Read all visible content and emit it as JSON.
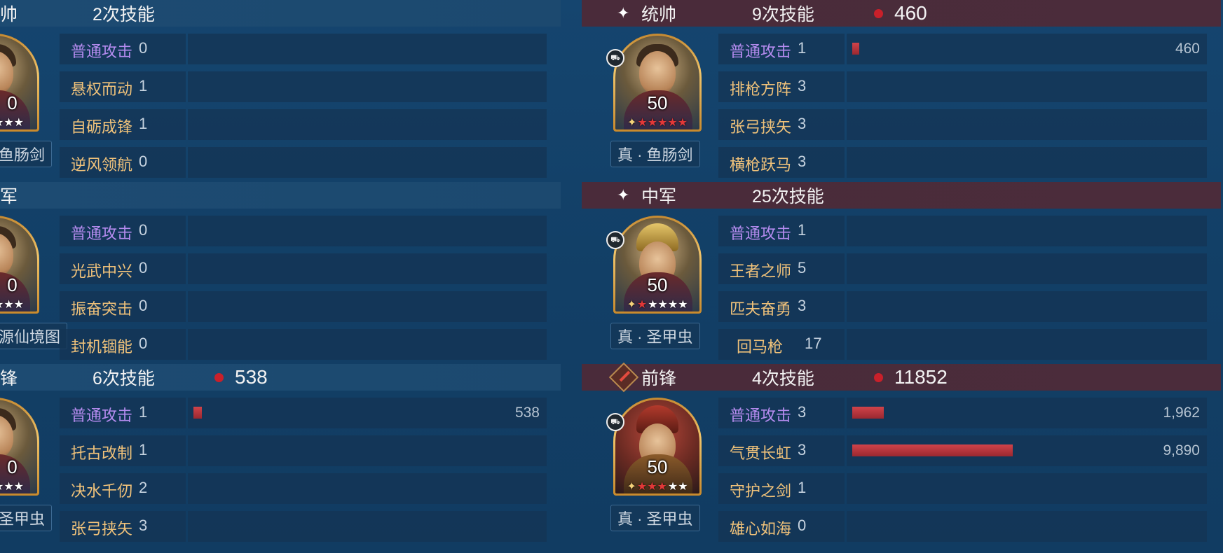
{
  "left_panel": {
    "sections": [
      {
        "role": "帅",
        "skills_label": "2次技能",
        "level": "0",
        "weapon": "鱼肠剑",
        "rows": [
          {
            "name": "普通攻击",
            "count": "0"
          },
          {
            "name": "悬权而动",
            "count": "1"
          },
          {
            "name": "自砺成锋",
            "count": "1"
          },
          {
            "name": "逆风领航",
            "count": "0"
          }
        ]
      },
      {
        "role": "军",
        "skills_label": "",
        "level": "0",
        "weapon": "源仙境图",
        "rows": [
          {
            "name": "普通攻击",
            "count": "0"
          },
          {
            "name": "光武中兴",
            "count": "0"
          },
          {
            "name": "振奋突击",
            "count": "0"
          },
          {
            "name": "封机锢能",
            "count": "0"
          }
        ]
      },
      {
        "role": "锋",
        "skills_label": "6次技能",
        "damage": "538",
        "level": "0",
        "weapon": "圣甲虫",
        "rows": [
          {
            "name": "普通攻击",
            "count": "1",
            "bar_fraction": 0.025,
            "value": "538"
          },
          {
            "name": "托古改制",
            "count": "1"
          },
          {
            "name": "决水千仞",
            "count": "2"
          },
          {
            "name": "张弓挟矢",
            "count": "3"
          }
        ]
      }
    ]
  },
  "right_panel": {
    "sections": [
      {
        "role": "统帅",
        "skills_label": "9次技能",
        "damage": "460",
        "level": "50",
        "weapon": "真 · 鱼肠剑",
        "stars_red": 6,
        "rows": [
          {
            "name": "普通攻击",
            "count": "1",
            "bar_fraction": 0.021,
            "value": "460"
          },
          {
            "name": "排枪方阵",
            "count": "3"
          },
          {
            "name": "张弓挟矢",
            "count": "3"
          },
          {
            "name": "横枪跃马",
            "count": "3"
          }
        ]
      },
      {
        "role": "中军",
        "skills_label": "25次技能",
        "level": "50",
        "weapon": "真 · 圣甲虫",
        "stars_red": 1,
        "rows": [
          {
            "name": "普通攻击",
            "count": "1"
          },
          {
            "name": "王者之师",
            "count": "5"
          },
          {
            "name": "匹夫奋勇",
            "count": "3"
          },
          {
            "name": "回马枪",
            "count": "17"
          }
        ]
      },
      {
        "role": "前锋",
        "skills_label": "4次技能",
        "damage": "11852",
        "level": "50",
        "weapon": "真 · 圣甲虫",
        "stars_red": 3,
        "rows": [
          {
            "name": "普通攻击",
            "count": "3",
            "bar_fraction": 0.09,
            "value": "1,962"
          },
          {
            "name": "气贯长虹",
            "count": "3",
            "bar_fraction": 0.46,
            "value": "9,890"
          },
          {
            "name": "守护之剑",
            "count": "1"
          },
          {
            "name": "雄心如海",
            "count": "0"
          }
        ]
      }
    ]
  },
  "colors": {
    "normal_attack": "#b68cf0",
    "skill_name": "#f0c27a",
    "damage_bar": "#c33a42",
    "right_header": "#4a2b3a",
    "left_header": "#1d4b72"
  },
  "icons": {
    "right_header_0": "sparkle-icon",
    "right_header_1": "sparkle-icon",
    "right_header_2": "sword-diamond-icon"
  }
}
